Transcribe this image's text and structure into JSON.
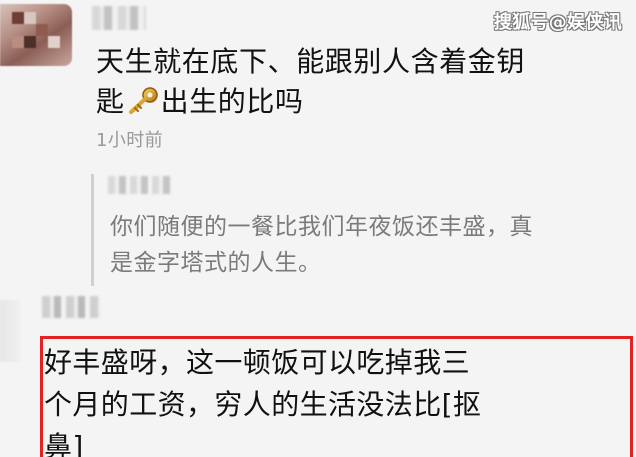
{
  "watermark": {
    "text": "搜狐号@娱侠讯"
  },
  "comments": [
    {
      "text_before_icon": "天生就在底下、能跟别人含着金钥\n匙",
      "icon": "key-icon",
      "text_after_icon": "出生的比吗",
      "timestamp": "1小时前"
    },
    {
      "text": "好丰盛呀，这一顿饭可以吃掉我三\n个月的工资，穷人的生活没法比[抠\n鼻]"
    }
  ],
  "quoted_reply": {
    "text": "你们随便的一餐比我们年夜饭还丰盛，真\n是金字塔式的人生。"
  },
  "colors": {
    "background": "#f4f4f4",
    "text": "#121212",
    "muted": "#999999",
    "quote_text": "#7b7b7b",
    "highlight_border": "#e52222",
    "key": "#d8a12d"
  }
}
